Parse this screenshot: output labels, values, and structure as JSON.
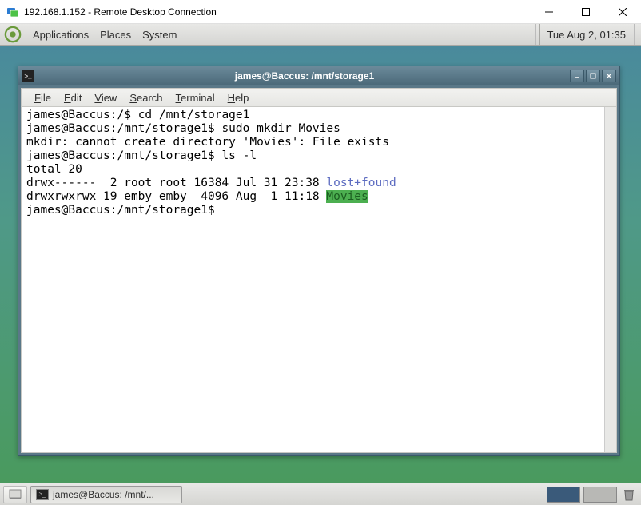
{
  "rdc": {
    "title": "192.168.1.152 - Remote Desktop Connection"
  },
  "mate_panel": {
    "menus": [
      "Applications",
      "Places",
      "System"
    ],
    "clock": "Tue Aug  2, 01:35"
  },
  "terminal": {
    "title": "james@Baccus: /mnt/storage1",
    "menus": [
      {
        "ul": "F",
        "rest": "ile"
      },
      {
        "ul": "E",
        "rest": "dit"
      },
      {
        "ul": "V",
        "rest": "iew"
      },
      {
        "ul": "S",
        "rest": "earch"
      },
      {
        "ul": "T",
        "rest": "erminal"
      },
      {
        "ul": "H",
        "rest": "elp"
      }
    ],
    "lines": {
      "l1_prompt": "james@Baccus:/$ ",
      "l1_cmd": "cd /mnt/storage1",
      "l2_prompt": "james@Baccus:/mnt/storage1$ ",
      "l2_cmd": "sudo mkdir Movies",
      "l3": "mkdir: cannot create directory 'Movies': File exists",
      "l4_prompt": "james@Baccus:/mnt/storage1$ ",
      "l4_cmd": "ls -l",
      "l5": "total 20",
      "l6_pre": "drwx------  2 root root 16384 Jul 31 23:38 ",
      "l6_dir": "lost+found",
      "l7_pre": "drwxrwxrwx 19 emby emby  4096 Aug  1 11:18 ",
      "l7_dir": "Movies",
      "l8_prompt": "james@Baccus:/mnt/storage1$ "
    }
  },
  "taskbar": {
    "task_label": "james@Baccus: /mnt/..."
  }
}
